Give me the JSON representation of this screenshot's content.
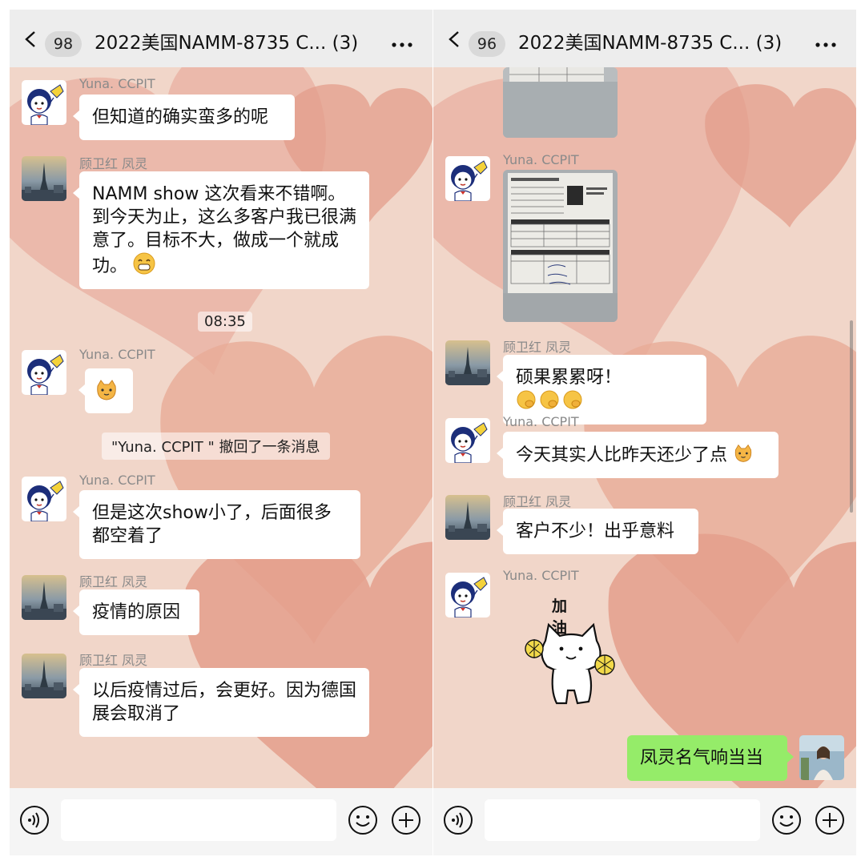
{
  "colors": {
    "chat_bg": "#f1d6c9",
    "heart": "#e5a391",
    "my_bubble": "#95ec69",
    "their_bubble": "#ffffff"
  },
  "left_panel": {
    "header": {
      "unread_count": "98",
      "title": "2022美国NAMM-8735 C... (3)"
    },
    "messages": [
      {
        "sender": "Yuna. CCPIT",
        "text": "但知道的确实蛮多的呢"
      },
      {
        "sender": "顾卫红 凤灵",
        "text": "NAMM show 这次看来不错啊。到今天为止，这么多客户我已很满意了。目标不大，做成一个就成功。"
      },
      {
        "time": "08:35"
      },
      {
        "sender": "Yuna. CCPIT",
        "emoji": "cat-face-emoji"
      },
      {
        "system": "\"Yuna. CCPIT \" 撤回了一条消息"
      },
      {
        "sender": "Yuna. CCPIT",
        "text": "但是这次show小了，后面很多都空着了"
      },
      {
        "sender": "顾卫红 凤灵",
        "text": "疫情的原因"
      },
      {
        "sender": "顾卫红 凤灵",
        "text": "以后疫情过后，会更好。因为德国展会取消了"
      }
    ]
  },
  "right_panel": {
    "header": {
      "unread_count": "96",
      "title": "2022美国NAMM-8735 C... (3)"
    },
    "messages": [
      {
        "image": "form-photo-partial"
      },
      {
        "sender": "Yuna. CCPIT",
        "image": "lead-form-photo"
      },
      {
        "sender": "顾卫红 凤灵",
        "text": "硕果累累呀！"
      },
      {
        "sender": "Yuna. CCPIT",
        "text": "今天其实人比昨天还少了点"
      },
      {
        "sender": "顾卫红 凤灵",
        "text": "客户不少！出乎意料"
      },
      {
        "sender": "Yuna. CCPIT",
        "sticker": "cheer-cat-sticker",
        "sticker_text": "加油"
      },
      {
        "mine": true,
        "text": "凤灵名气响当当"
      }
    ]
  },
  "icons": {
    "back": "chevron-left-icon",
    "more": "more-dots-icon",
    "voice": "voice-icon",
    "emoji": "smiley-icon",
    "plus": "plus-icon"
  }
}
